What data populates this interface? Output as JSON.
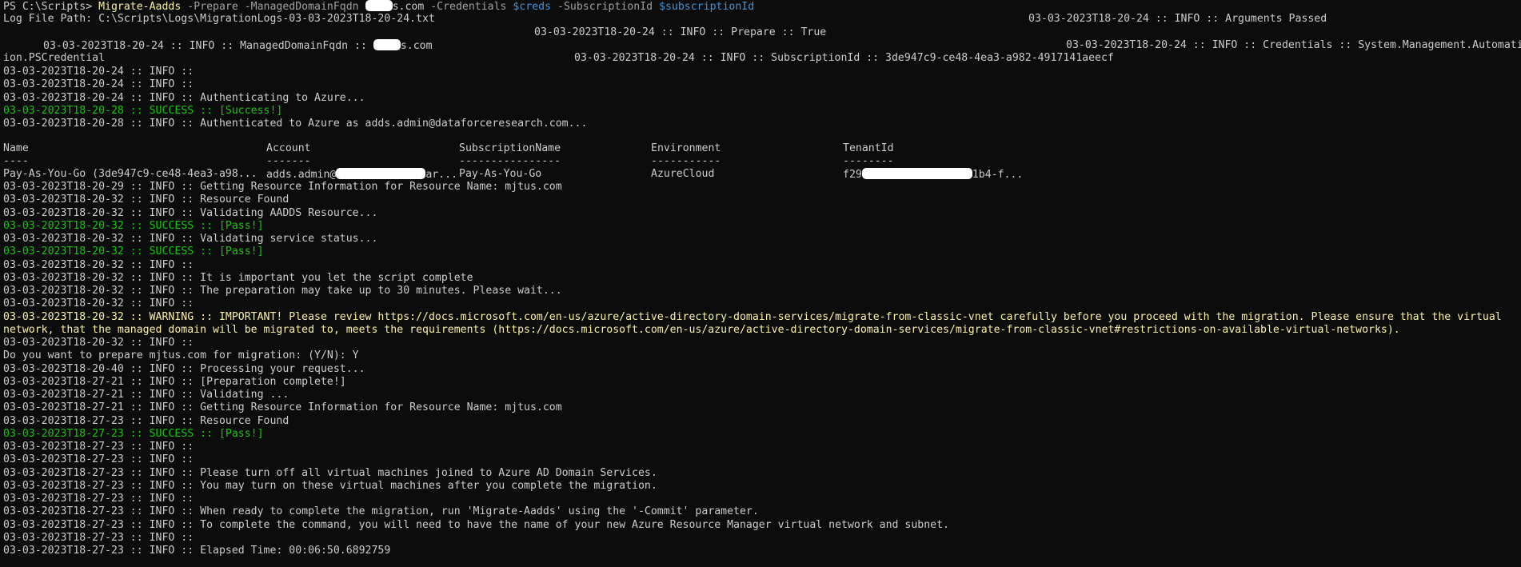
{
  "window": {
    "type": "PowerShell console"
  },
  "colors": {
    "background": "#0c0c0c",
    "text": "#cccccc",
    "command": "#f9f1a5",
    "parameter": "#a0a0a0",
    "variable": "#3a96dd",
    "success": "#16c60c",
    "warning": "#f9f1a5",
    "redaction": "#ffffff"
  },
  "prompt": {
    "path": "PS C:\\Scripts> ",
    "command": "Migrate-Aadds",
    "param1": " -Prepare -ManagedDomainFqdn ",
    "domain_suffix": "s.com",
    "param2": " -Credentials ",
    "var1": "$creds",
    "param3": " -SubscriptionId ",
    "var2": "$subscriptionId"
  },
  "logpath": {
    "text": "Log File Path: C:\\Scripts\\Logs\\MigrationLogs-03-03-2023T18-20-24.txt",
    "args_passed": "03-03-2023T18-20-24 :: INFO :: Arguments Passed",
    "prepare": "03-03-2023T18-20-24 :: INFO :: Prepare :: True"
  },
  "managed_domain": {
    "prefix": "03-03-2023T18-20-24 :: INFO :: ManagedDomainFqdn :: ",
    "suffix": "s.com",
    "credentials": "03-03-2023T18-20-24 :: INFO :: Credentials :: System.Management.Automati"
  },
  "wrap_cred": {
    "text": "ion.PSCredential",
    "subscription": "03-03-2023T18-20-24 :: INFO :: SubscriptionId :: 3de947c9-ce48-4ea3-a982-4917141aeecf"
  },
  "table": {
    "headers": [
      "Name",
      "Account",
      "SubscriptionName",
      "Environment",
      "TenantId"
    ],
    "dashes": [
      "----",
      "-------",
      "----------------",
      "-----------",
      "--------"
    ],
    "row": {
      "name": "Pay-As-You-Go (3de947c9-ce48-4ea3-a98...",
      "account_prefix": "adds.admin@",
      "account_suffix": "ar...",
      "subscription": "Pay-As-You-Go",
      "environment": "AzureCloud",
      "tenant_prefix": "f29",
      "tenant_suffix": "1b4-f..."
    }
  },
  "log_before": [
    {
      "text": "03-03-2023T18-20-24 :: INFO ::",
      "kind": "info"
    },
    {
      "text": "03-03-2023T18-20-24 :: INFO ::",
      "kind": "info"
    },
    {
      "text": "03-03-2023T18-20-24 :: INFO :: Authenticating to Azure...",
      "kind": "info"
    },
    {
      "text": "03-03-2023T18-20-28 :: SUCCESS :: [Success!]",
      "kind": "success"
    },
    {
      "text": "03-03-2023T18-20-28 :: INFO :: Authenticated to Azure as adds.admin@dataforceresearch.com...",
      "kind": "info"
    }
  ],
  "log_after": [
    {
      "text": "03-03-2023T18-20-29 :: INFO :: Getting Resource Information for Resource Name: mjtus.com",
      "kind": "info"
    },
    {
      "text": "03-03-2023T18-20-32 :: INFO :: Resource Found",
      "kind": "info"
    },
    {
      "text": "03-03-2023T18-20-32 :: INFO :: Validating AADDS Resource...",
      "kind": "info"
    },
    {
      "text": "03-03-2023T18-20-32 :: SUCCESS :: [Pass!]",
      "kind": "success"
    },
    {
      "text": "03-03-2023T18-20-32 :: INFO :: Validating service status...",
      "kind": "info"
    },
    {
      "text": "03-03-2023T18-20-32 :: SUCCESS :: [Pass!]",
      "kind": "success"
    },
    {
      "text": "03-03-2023T18-20-32 :: INFO ::",
      "kind": "info"
    },
    {
      "text": "03-03-2023T18-20-32 :: INFO :: It is important you let the script complete",
      "kind": "info"
    },
    {
      "text": "03-03-2023T18-20-32 :: INFO :: The preparation may take up to 30 minutes. Please wait...",
      "kind": "info"
    },
    {
      "text": "03-03-2023T18-20-32 :: INFO ::",
      "kind": "info"
    },
    {
      "text": "03-03-2023T18-20-32 :: WARNING :: IMPORTANT! Please review https://docs.microsoft.com/en-us/azure/active-directory-domain-services/migrate-from-classic-vnet carefully before you proceed with the migration. Please ensure that the virtual",
      "kind": "warning"
    },
    {
      "text": "network, that the managed domain will be migrated to, meets the requirements (https://docs.microsoft.com/en-us/azure/active-directory-domain-services/migrate-from-classic-vnet#restrictions-on-available-virtual-networks).",
      "kind": "warning"
    },
    {
      "text": "03-03-2023T18-20-32 :: INFO ::",
      "kind": "info"
    },
    {
      "text": "Do you want to prepare mjtus.com for migration: (Y/N): Y",
      "kind": "info"
    },
    {
      "text": "03-03-2023T18-20-40 :: INFO :: Processing your request...",
      "kind": "info"
    },
    {
      "text": "03-03-2023T18-27-21 :: INFO :: [Preparation complete!]",
      "kind": "info"
    },
    {
      "text": "03-03-2023T18-27-21 :: INFO :: Validating ...",
      "kind": "info"
    },
    {
      "text": "03-03-2023T18-27-21 :: INFO :: Getting Resource Information for Resource Name: mjtus.com",
      "kind": "info"
    },
    {
      "text": "03-03-2023T18-27-23 :: INFO :: Resource Found",
      "kind": "info"
    },
    {
      "text": "03-03-2023T18-27-23 :: SUCCESS :: [Pass!]",
      "kind": "success"
    },
    {
      "text": "03-03-2023T18-27-23 :: INFO ::",
      "kind": "info"
    },
    {
      "text": "03-03-2023T18-27-23 :: INFO ::",
      "kind": "info"
    },
    {
      "text": "03-03-2023T18-27-23 :: INFO :: Please turn off all virtual machines joined to Azure AD Domain Services.",
      "kind": "info"
    },
    {
      "text": "03-03-2023T18-27-23 :: INFO :: You may turn on these virtual machines after you complete the migration.",
      "kind": "info"
    },
    {
      "text": "03-03-2023T18-27-23 :: INFO ::",
      "kind": "info"
    },
    {
      "text": "03-03-2023T18-27-23 :: INFO :: When ready to complete the migration, run 'Migrate-Aadds' using the '-Commit' parameter.",
      "kind": "info"
    },
    {
      "text": "03-03-2023T18-27-23 :: INFO :: To complete the command, you will need to have the name of your new Azure Resource Manager virtual network and subnet.",
      "kind": "info"
    },
    {
      "text": "03-03-2023T18-27-23 :: INFO ::",
      "kind": "info"
    },
    {
      "text": "03-03-2023T18-27-23 :: INFO :: Elapsed Time: 00:06:50.6892759",
      "kind": "info"
    }
  ]
}
